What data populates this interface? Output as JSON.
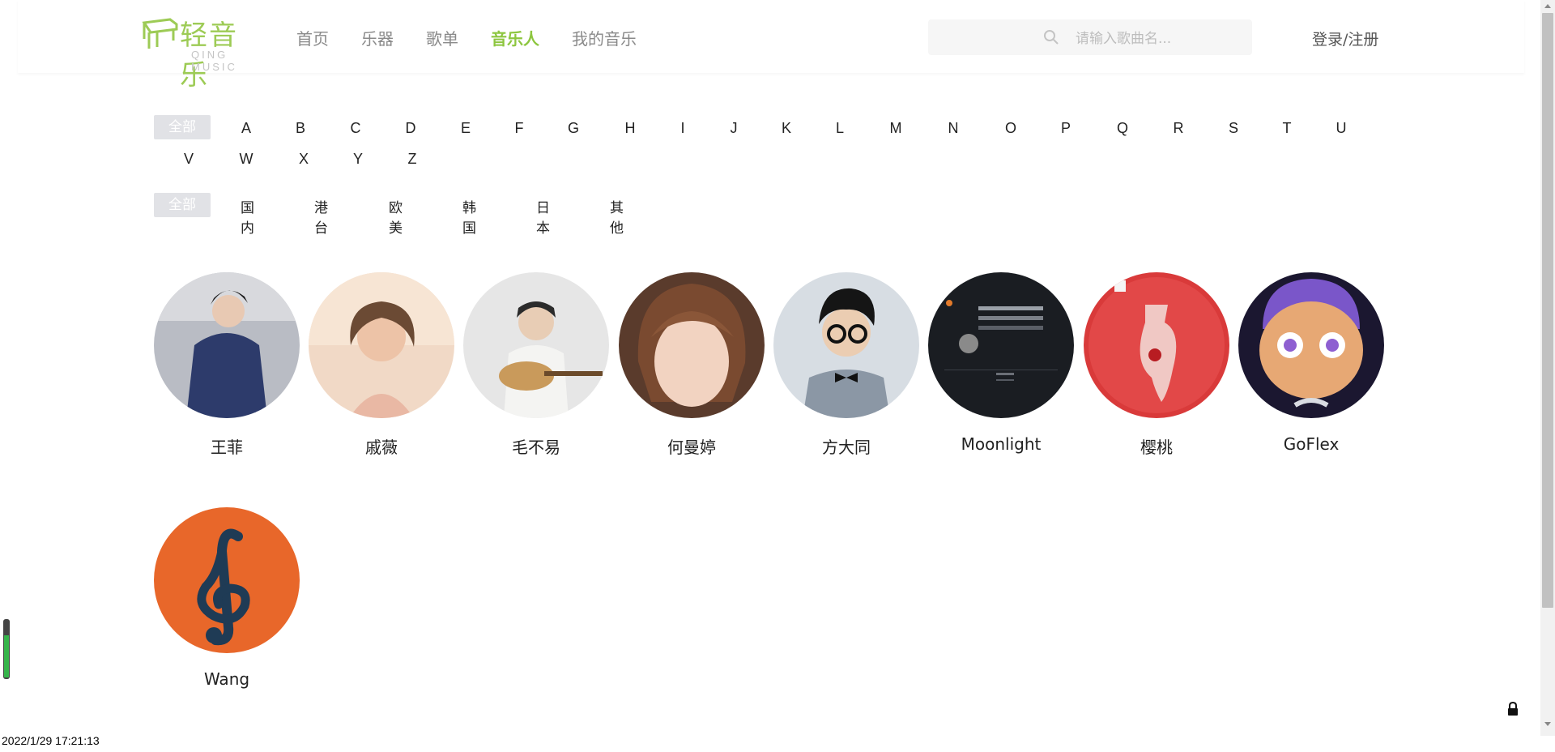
{
  "header": {
    "logo": {
      "name": "轻音乐",
      "sub": "QING MUSIC"
    },
    "nav": [
      {
        "label": "首页"
      },
      {
        "label": "乐器"
      },
      {
        "label": "歌单"
      },
      {
        "label": "音乐人"
      },
      {
        "label": "我的音乐"
      }
    ],
    "active_nav": "音乐人",
    "search": {
      "placeholder": "请输入歌曲名...",
      "value": ""
    },
    "login_label": "登录/注册"
  },
  "filters": {
    "letters_all": "全部",
    "letters": [
      "A",
      "B",
      "C",
      "D",
      "E",
      "F",
      "G",
      "H",
      "I",
      "J",
      "K",
      "L",
      "M",
      "N",
      "O",
      "P",
      "Q",
      "R",
      "S",
      "T",
      "U",
      "V",
      "W",
      "X",
      "Y",
      "Z"
    ],
    "regions_all": "全部",
    "regions": [
      "国内",
      "港台",
      "欧美",
      "韩国",
      "日本",
      "其他"
    ]
  },
  "artists": [
    {
      "name": "王菲"
    },
    {
      "name": "戚薇"
    },
    {
      "name": "毛不易"
    },
    {
      "name": "何曼婷"
    },
    {
      "name": "方大同"
    },
    {
      "name": "Moonlight"
    },
    {
      "name": "樱桃"
    },
    {
      "name": "GoFlex"
    },
    {
      "name": "Wang"
    }
  ],
  "colors": {
    "accent": "#8dc63f",
    "logo": "#9dcb55",
    "chip_bg": "#e1e2e6",
    "nav_text": "#8a8a8a"
  },
  "status": {
    "timestamp": "2022/1/29 17:21:13"
  }
}
